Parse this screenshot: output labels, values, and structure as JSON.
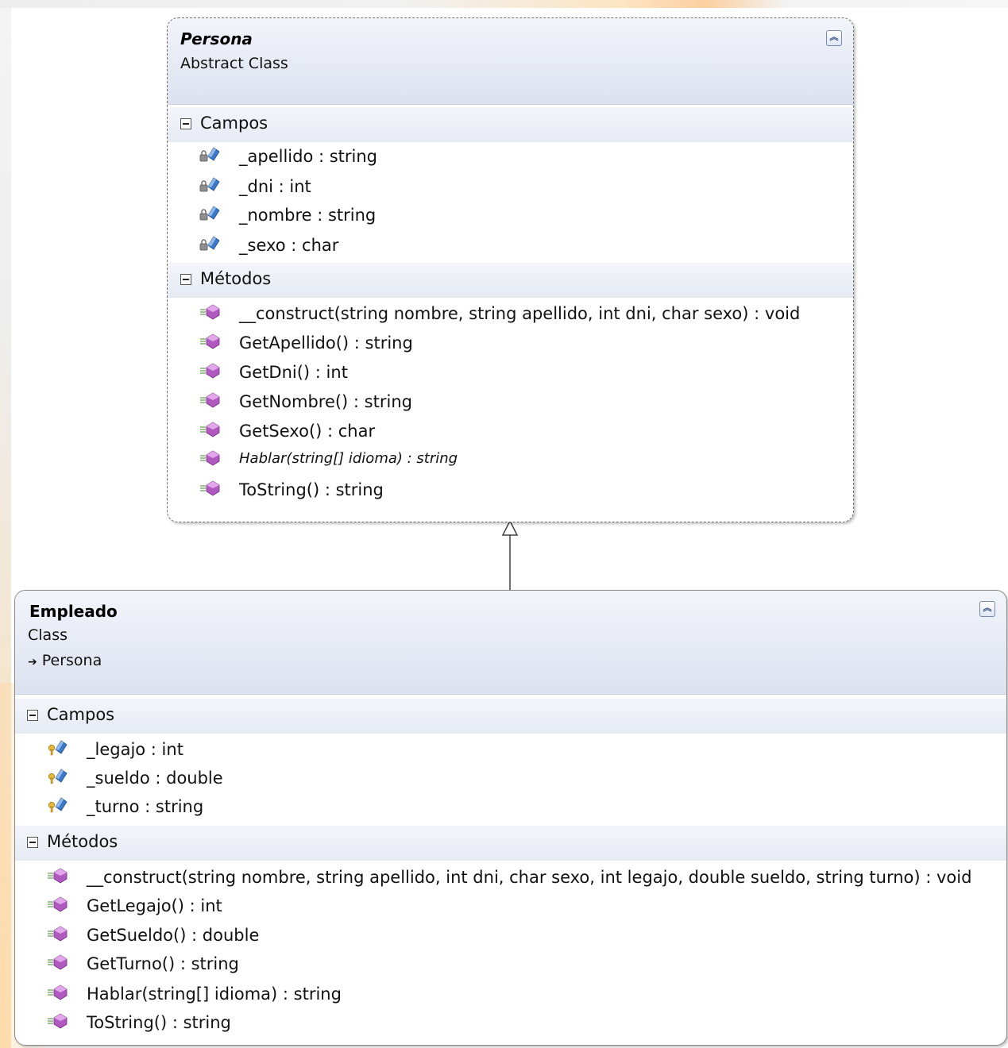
{
  "persona": {
    "name": "Persona",
    "kind": "Abstract Class",
    "sections": {
      "fields_label": "Campos",
      "methods_label": "Métodos"
    },
    "fields": [
      "_apellido : string",
      "_dni : int",
      "_nombre : string",
      "_sexo : char"
    ],
    "methods": [
      "__construct(string nombre, string apellido, int dni, char sexo) : void",
      "GetApellido() : string",
      "GetDni() : int",
      "GetNombre() : string",
      "GetSexo() : char",
      "Hablar(string[] idioma) : string",
      "ToString() : string"
    ]
  },
  "empleado": {
    "name": "Empleado",
    "kind": "Class",
    "base": "Persona",
    "sections": {
      "fields_label": "Campos",
      "methods_label": "Métodos"
    },
    "fields": [
      "_legajo : int",
      "_sueldo : double",
      "_turno : string"
    ],
    "methods": [
      "__construct(string nombre, string apellido, int dni, char sexo, int legajo, double sueldo, string turno) : void",
      "GetLegajo() : int",
      "GetSueldo() : double",
      "GetTurno() : string",
      "Hablar(string[] idioma) : string",
      "ToString() : string"
    ]
  },
  "icons": {
    "private_field": "private-field-icon",
    "protected_field": "protected-field-icon",
    "method": "method-icon",
    "collapse": "collapse-chevron-icon",
    "section_toggle": "section-minus-icon",
    "inherit_arrow": "inheritance-arrow-icon"
  },
  "colors": {
    "header_gradient_top": "#f2f4fa",
    "header_gradient_bottom": "#dde2f0",
    "method_icon": "#b05ac0",
    "field_icon": "#3c78c8"
  }
}
